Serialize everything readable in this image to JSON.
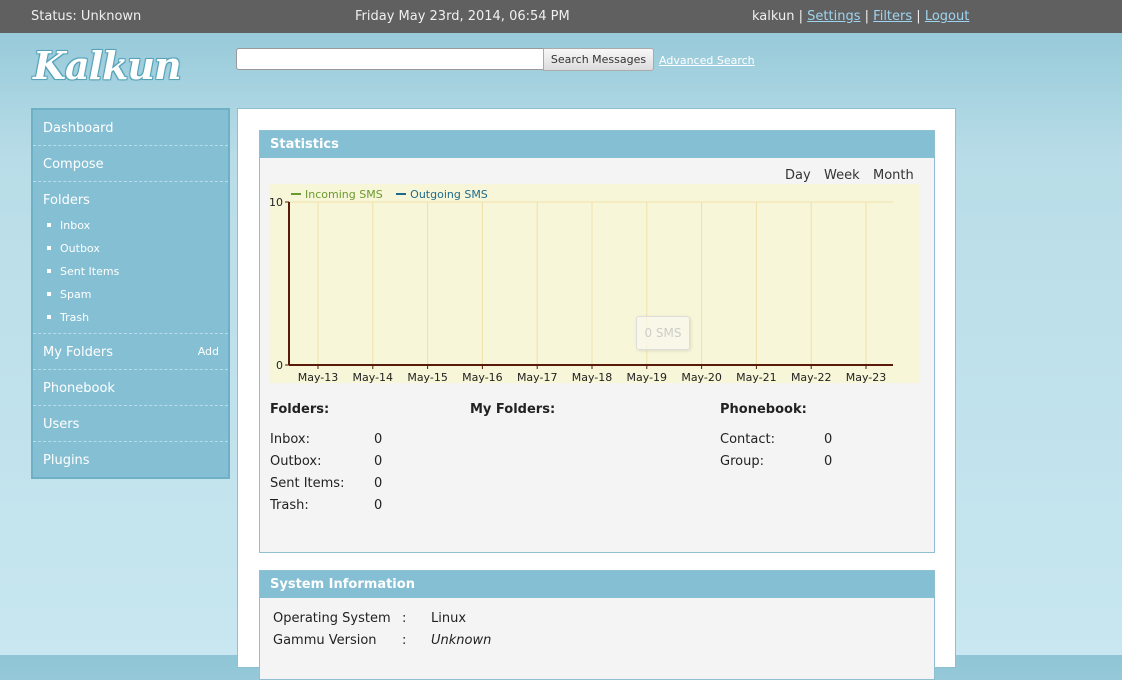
{
  "topbar": {
    "status": "Status: Unknown",
    "datetime": "Friday May 23rd, 2014, 06:54 PM",
    "username": "kalkun",
    "links": {
      "settings": "Settings",
      "filters": "Filters",
      "logout": "Logout"
    },
    "separator": "|"
  },
  "logo": {
    "text": "Kalkun"
  },
  "search": {
    "value": "",
    "placeholder": "",
    "button_label": "Search Messages",
    "advanced_label": "Advanced Search"
  },
  "sidebar": {
    "dashboard": "Dashboard",
    "compose": "Compose",
    "folders": "Folders",
    "folder_items": [
      "Inbox",
      "Outbox",
      "Sent Items",
      "Spam",
      "Trash"
    ],
    "my_folders": "My Folders",
    "add_label": "Add",
    "phonebook": "Phonebook",
    "users": "Users",
    "plugins": "Plugins"
  },
  "statistics": {
    "title": "Statistics",
    "ranges": [
      "Day",
      "Week",
      "Month"
    ],
    "tooltip": "0 SMS"
  },
  "chart_data": {
    "type": "line",
    "categories": [
      "May-13",
      "May-14",
      "May-15",
      "May-16",
      "May-17",
      "May-18",
      "May-19",
      "May-20",
      "May-21",
      "May-22",
      "May-23"
    ],
    "series": [
      {
        "name": "Incoming SMS",
        "values": [
          0,
          0,
          0,
          0,
          0,
          0,
          0,
          0,
          0,
          0,
          0
        ]
      },
      {
        "name": "Outgoing SMS",
        "values": [
          0,
          0,
          0,
          0,
          0,
          0,
          0,
          0,
          0,
          0,
          0
        ]
      }
    ],
    "ylim": [
      0,
      10
    ],
    "yticks": [
      "0",
      "10"
    ],
    "legend": "top-left",
    "grid": true,
    "colors": {
      "incoming": "#6a9a2f",
      "outgoing": "#1f6a8a",
      "axis": "#5a1a0a",
      "grid": "#efe0a8"
    }
  },
  "folders": {
    "title": "Folders:",
    "rows": [
      {
        "label": "Inbox:",
        "value": "0"
      },
      {
        "label": "Outbox:",
        "value": "0"
      },
      {
        "label": "Sent Items:",
        "value": "0"
      },
      {
        "label": "Trash:",
        "value": "0"
      }
    ]
  },
  "my_folders": {
    "title": "My Folders:"
  },
  "phonebook": {
    "title": "Phonebook:",
    "rows": [
      {
        "label": "Contact:",
        "value": "0"
      },
      {
        "label": "Group:",
        "value": "0"
      }
    ]
  },
  "system_info": {
    "title": "System Information",
    "colon": ":",
    "rows": [
      {
        "label": "Operating System",
        "value": "Linux"
      },
      {
        "label": "Gammu Version",
        "value": "Unknown"
      }
    ]
  }
}
